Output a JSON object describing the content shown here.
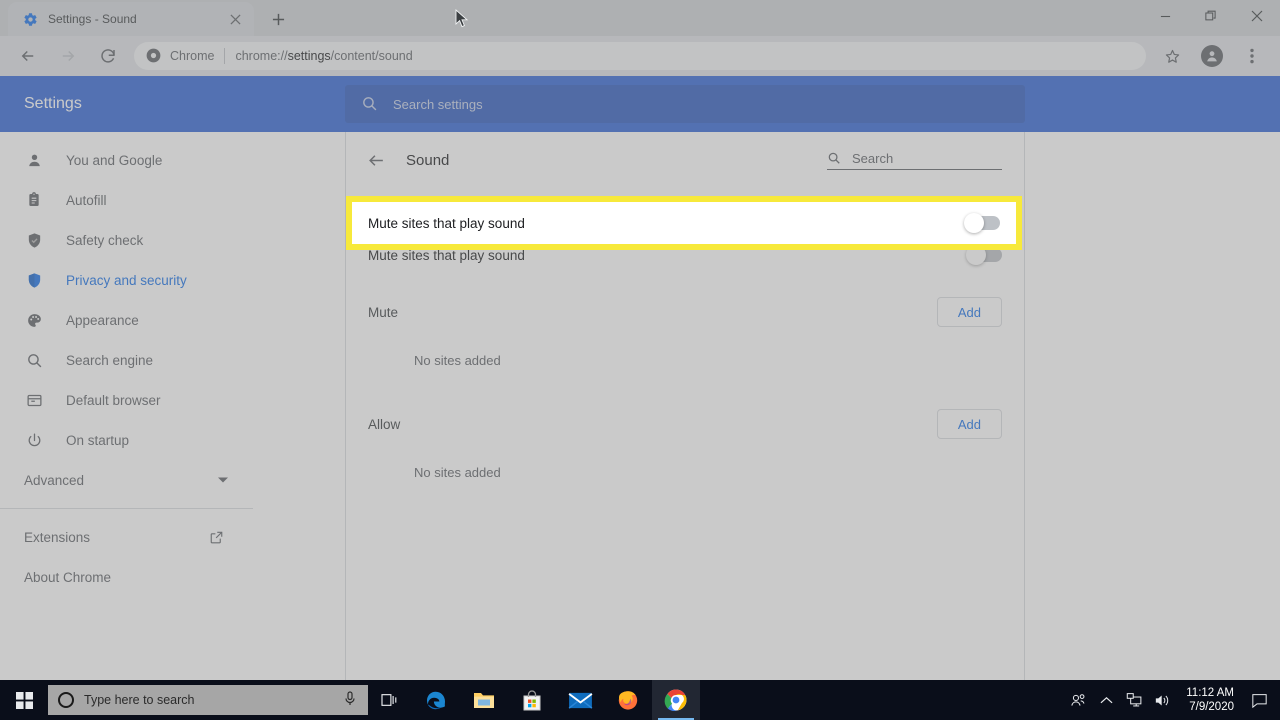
{
  "browser": {
    "tab": {
      "title": "Settings - Sound",
      "favicon_name": "settings-gear-icon",
      "close_label": "×",
      "newtab_label": "+"
    },
    "window_controls": {
      "minimize": "—",
      "maximize": "❐",
      "close": "✕"
    },
    "toolbar": {
      "back_icon": "back-arrow-icon",
      "forward_icon": "forward-arrow-icon",
      "reload_icon": "reload-icon",
      "omnibox": {
        "chip_label": "Chrome",
        "url_prefix": "chrome://",
        "url_highlight": "settings",
        "url_suffix": "/content/sound",
        "full_url": "chrome://settings/content/sound"
      },
      "bookmark_icon": "star-icon",
      "profile_icon": "profile-avatar-icon",
      "menu_icon": "three-dot-menu-icon"
    }
  },
  "settings": {
    "header": {
      "title": "Settings",
      "search_placeholder": "Search settings",
      "search_icon": "search-icon",
      "accent_color": "#3367d6"
    },
    "sidebar": {
      "items": [
        {
          "label": "You and Google",
          "icon": "person-icon",
          "selected": false
        },
        {
          "label": "Autofill",
          "icon": "clipboard-icon",
          "selected": false
        },
        {
          "label": "Safety check",
          "icon": "shield-check-icon",
          "selected": false
        },
        {
          "label": "Privacy and security",
          "icon": "shield-icon",
          "selected": true
        },
        {
          "label": "Appearance",
          "icon": "palette-icon",
          "selected": false
        },
        {
          "label": "Search engine",
          "icon": "search-icon",
          "selected": false
        },
        {
          "label": "Default browser",
          "icon": "browser-window-icon",
          "selected": false
        },
        {
          "label": "On startup",
          "icon": "power-icon",
          "selected": false
        }
      ],
      "advanced": {
        "label": "Advanced",
        "icon": "chevron-down-icon"
      },
      "links": [
        {
          "label": "Extensions",
          "icon": "external-link-icon"
        },
        {
          "label": "About Chrome",
          "icon": ""
        }
      ],
      "selected_color": "#1a73e8"
    },
    "main": {
      "back_icon": "back-arrow-icon",
      "page_title": "Sound",
      "search": {
        "placeholder": "Search",
        "icon": "search-icon"
      },
      "toggle_row": {
        "label": "Mute sites that play sound",
        "state": "off",
        "highlighted": true,
        "highlight_color": "#f7e93b"
      },
      "sections": [
        {
          "title": "Mute",
          "add_label": "Add",
          "empty_text": "No sites added"
        },
        {
          "title": "Allow",
          "add_label": "Add",
          "empty_text": "No sites added"
        }
      ]
    }
  },
  "taskbar": {
    "start_icon": "windows-start-icon",
    "search": {
      "placeholder": "Type here to search",
      "circle_icon": "cortana-circle-icon",
      "mic_icon": "microphone-icon"
    },
    "taskview_icon": "task-view-icon",
    "apps": [
      {
        "name": "Microsoft Edge",
        "icon": "edge-icon",
        "active": false
      },
      {
        "name": "File Explorer",
        "icon": "file-explorer-icon",
        "active": false
      },
      {
        "name": "Microsoft Store",
        "icon": "microsoft-store-icon",
        "active": false
      },
      {
        "name": "Mail",
        "icon": "mail-icon",
        "active": false
      },
      {
        "name": "Mozilla Firefox",
        "icon": "firefox-icon",
        "active": false
      },
      {
        "name": "Google Chrome",
        "icon": "chrome-icon",
        "active": true
      }
    ],
    "tray": {
      "people_icon": "people-icon",
      "show_hidden_icon": "chevron-up-icon",
      "network_icon": "network-icon",
      "volume_icon": "volume-icon",
      "time": "11:12 AM",
      "date": "7/9/2020",
      "notification_icon": "notification-icon"
    }
  }
}
